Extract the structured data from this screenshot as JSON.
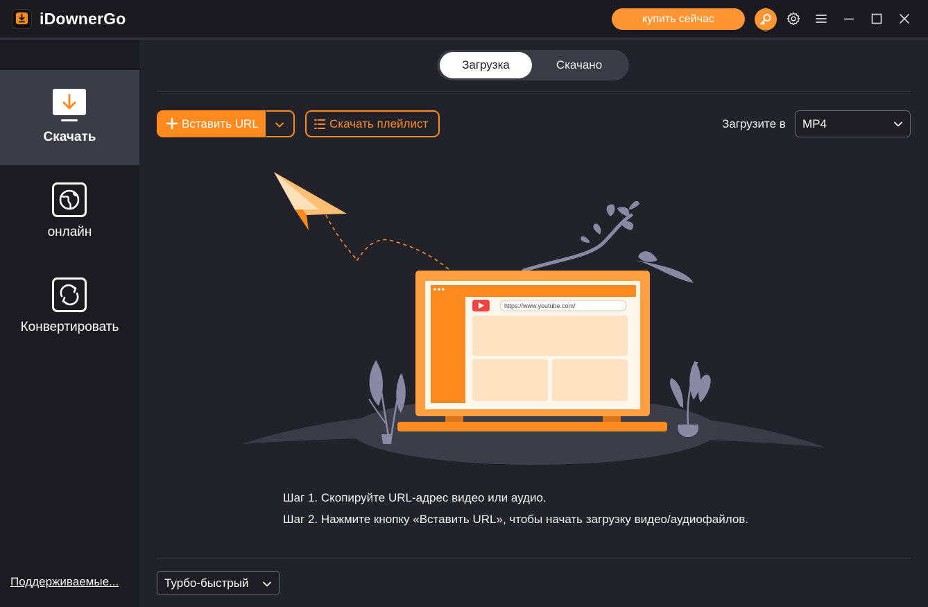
{
  "app": {
    "title": "iDownerGo",
    "buy_label": "купить сейчас",
    "accent_color": "#ff8a1f"
  },
  "sidebar": {
    "items": [
      {
        "label": "Скачать",
        "icon": "download-icon",
        "active": true
      },
      {
        "label": "онлайн",
        "icon": "globe-icon",
        "active": false
      },
      {
        "label": "Конвертировать",
        "icon": "convert-icon",
        "active": false
      }
    ],
    "supported_link": "Поддерживаемые..."
  },
  "tabs": [
    {
      "label": "Загрузка",
      "active": true
    },
    {
      "label": "Скачано",
      "active": false
    }
  ],
  "toolbar": {
    "paste_url_label": "Вставить URL",
    "download_playlist_label": "Скачать плейлист",
    "format_label": "Загрузите в",
    "format_value": "MP4"
  },
  "illustration": {
    "url_text": "https://www.youtube.com/"
  },
  "steps": {
    "step1": "Шаг 1. Скопируйте URL-адрес видео или аудио.",
    "step2": "Шаг 2. Нажмите кнопку «Вставить URL», чтобы начать загрузку видео/аудиофайлов."
  },
  "footer": {
    "speed_value": "Турбо-быстрый"
  }
}
